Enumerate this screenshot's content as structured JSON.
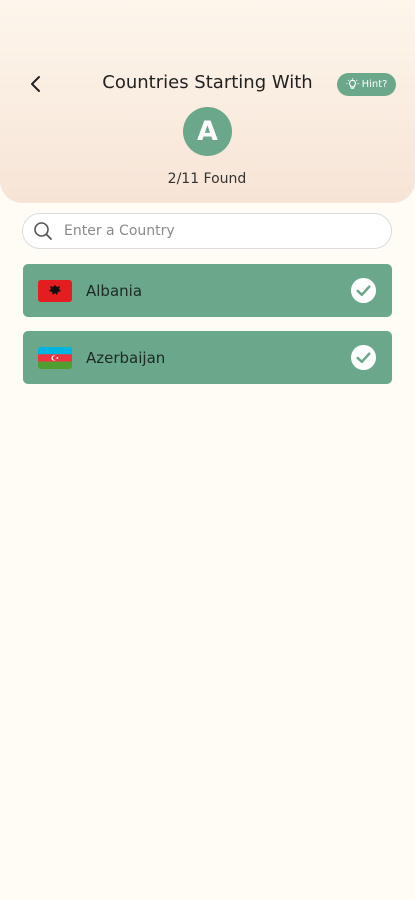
{
  "header": {
    "title": "Countries Starting With",
    "hint_label": "Hint?",
    "letter": "A",
    "found_count": "2/11 Found",
    "background_top": "#fdf6ec",
    "background_bottom": "#f7e4d6"
  },
  "search": {
    "placeholder": "Enter a Country",
    "value": ""
  },
  "countries": [
    {
      "name": "Albania",
      "flag_icon": "albania-flag-icon",
      "found": true
    },
    {
      "name": "Azerbaijan",
      "flag_icon": "azerbaijan-flag-icon",
      "found": true
    }
  ],
  "colors": {
    "accent": "#6aa78b",
    "row_background": "#6aa78b",
    "background": "#fefcf5"
  },
  "icons": {
    "back": "chevron-left-icon",
    "hint": "lightbulb-icon",
    "search": "search-icon",
    "check": "check-circle-icon"
  }
}
